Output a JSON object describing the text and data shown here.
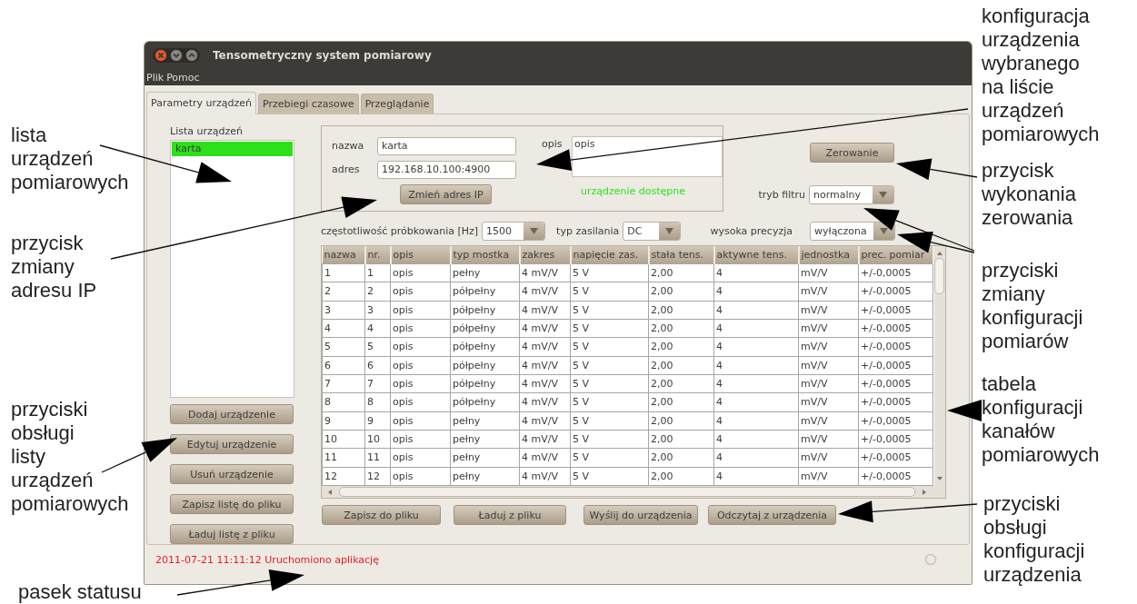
{
  "window": {
    "title": "Tensometryczny system pomiarowy",
    "menu": [
      "Plik",
      "Pomoc"
    ]
  },
  "tabs": [
    {
      "label": "Parametry urządzeń",
      "selected": true
    },
    {
      "label": "Przebiegi czasowe",
      "selected": false
    },
    {
      "label": "Przeglądanie",
      "selected": false
    }
  ],
  "device_list": {
    "label": "Lista urządzeń",
    "items": [
      {
        "name": "karta",
        "selected": true
      }
    ]
  },
  "list_buttons": [
    "Dodaj urządzenie",
    "Edytuj urządzenie",
    "Usuń urządzenie",
    "Zapisz listę do pliku",
    "Ładuj listę z pliku"
  ],
  "device_form": {
    "name_label": "nazwa",
    "name_value": "karta",
    "address_label": "adres",
    "address_value": "192.168.10.100:4900",
    "description_label": "opis",
    "description_value": "opis",
    "change_ip_button": "Zmień adres IP",
    "availability": "urządzenie dostępne"
  },
  "zero_button": "Zerowanie",
  "filter_mode": {
    "label": "tryb filtru",
    "value": "normalny"
  },
  "sampling_rate": {
    "label": "częstotliwość próbkowania [Hz]",
    "value": "1500"
  },
  "power_type": {
    "label": "typ zasilania",
    "value": "DC"
  },
  "high_precision": {
    "label": "wysoka precyzja",
    "value": "wyłączona"
  },
  "table": {
    "columns": [
      "nazwa",
      "nr.",
      "opis",
      "typ mostka",
      "zakres",
      "napięcie zas.",
      "stała tens.",
      "aktywne tens.",
      "jednostka",
      "prec. pomiar"
    ],
    "rows": [
      [
        "1",
        "1",
        "opis",
        "pełny",
        "4 mV/V",
        "5 V",
        "2,00",
        "4",
        "mV/V",
        "+/-0,0005"
      ],
      [
        "2",
        "2",
        "opis",
        "półpełny",
        "4 mV/V",
        "5 V",
        "2,00",
        "4",
        "mV/V",
        "+/-0,0005"
      ],
      [
        "3",
        "3",
        "opis",
        "półpełny",
        "4 mV/V",
        "5 V",
        "2,00",
        "4",
        "mV/V",
        "+/-0,0005"
      ],
      [
        "4",
        "4",
        "opis",
        "półpełny",
        "4 mV/V",
        "5 V",
        "2,00",
        "4",
        "mV/V",
        "+/-0,0005"
      ],
      [
        "5",
        "5",
        "opis",
        "półpełny",
        "4 mV/V",
        "5 V",
        "2,00",
        "4",
        "mV/V",
        "+/-0,0005"
      ],
      [
        "6",
        "6",
        "opis",
        "półpełny",
        "4 mV/V",
        "5 V",
        "2,00",
        "4",
        "mV/V",
        "+/-0,0005"
      ],
      [
        "7",
        "7",
        "opis",
        "półpełny",
        "4 mV/V",
        "5 V",
        "2,00",
        "4",
        "mV/V",
        "+/-0,0005"
      ],
      [
        "8",
        "8",
        "opis",
        "półpełny",
        "4 mV/V",
        "5 V",
        "2,00",
        "4",
        "mV/V",
        "+/-0,0005"
      ],
      [
        "9",
        "9",
        "opis",
        "pełny",
        "4 mV/V",
        "5 V",
        "2,00",
        "4",
        "mV/V",
        "+/-0,0005"
      ],
      [
        "10",
        "10",
        "opis",
        "pełny",
        "4 mV/V",
        "5 V",
        "2,00",
        "4",
        "mV/V",
        "+/-0,0005"
      ],
      [
        "11",
        "11",
        "opis",
        "pełny",
        "4 mV/V",
        "5 V",
        "2,00",
        "4",
        "mV/V",
        "+/-0,0005"
      ],
      [
        "12",
        "12",
        "opis",
        "pełny",
        "4 mV/V",
        "5 V",
        "2,00",
        "4",
        "mV/V",
        "+/-0,0005"
      ]
    ]
  },
  "config_buttons": [
    "Zapisz do pliku",
    "Ładuj z pliku",
    "Wyślij do urządzenia",
    "Odczytaj z urządzenia"
  ],
  "status_bar": {
    "text": "2011-07-21 11:11:12 Uruchomiono aplikację"
  },
  "annotations": [
    {
      "text": "lista\nurządzeń\npomiarowych"
    },
    {
      "text": "przycisk\nzmiany\nadresu IP"
    },
    {
      "text": "przyciski\nobsługi\nlisty\nurządzeń\npomiarowych"
    },
    {
      "text": "pasek statusu"
    },
    {
      "text": "konfiguracja\nurządzenia\nwybranego\nna liście\nurządzeń\npomiarowych"
    },
    {
      "text": "przycisk\nwykonania\nzerowania"
    },
    {
      "text": "przyciski\nzmiany\nkonfiguracji\npomiarów"
    },
    {
      "text": "tabela\nkonfiguracji\nkanałów\npomiarowych"
    },
    {
      "text": "przyciski\nobsługi\nkonfiguracji\nurządzenia"
    }
  ]
}
